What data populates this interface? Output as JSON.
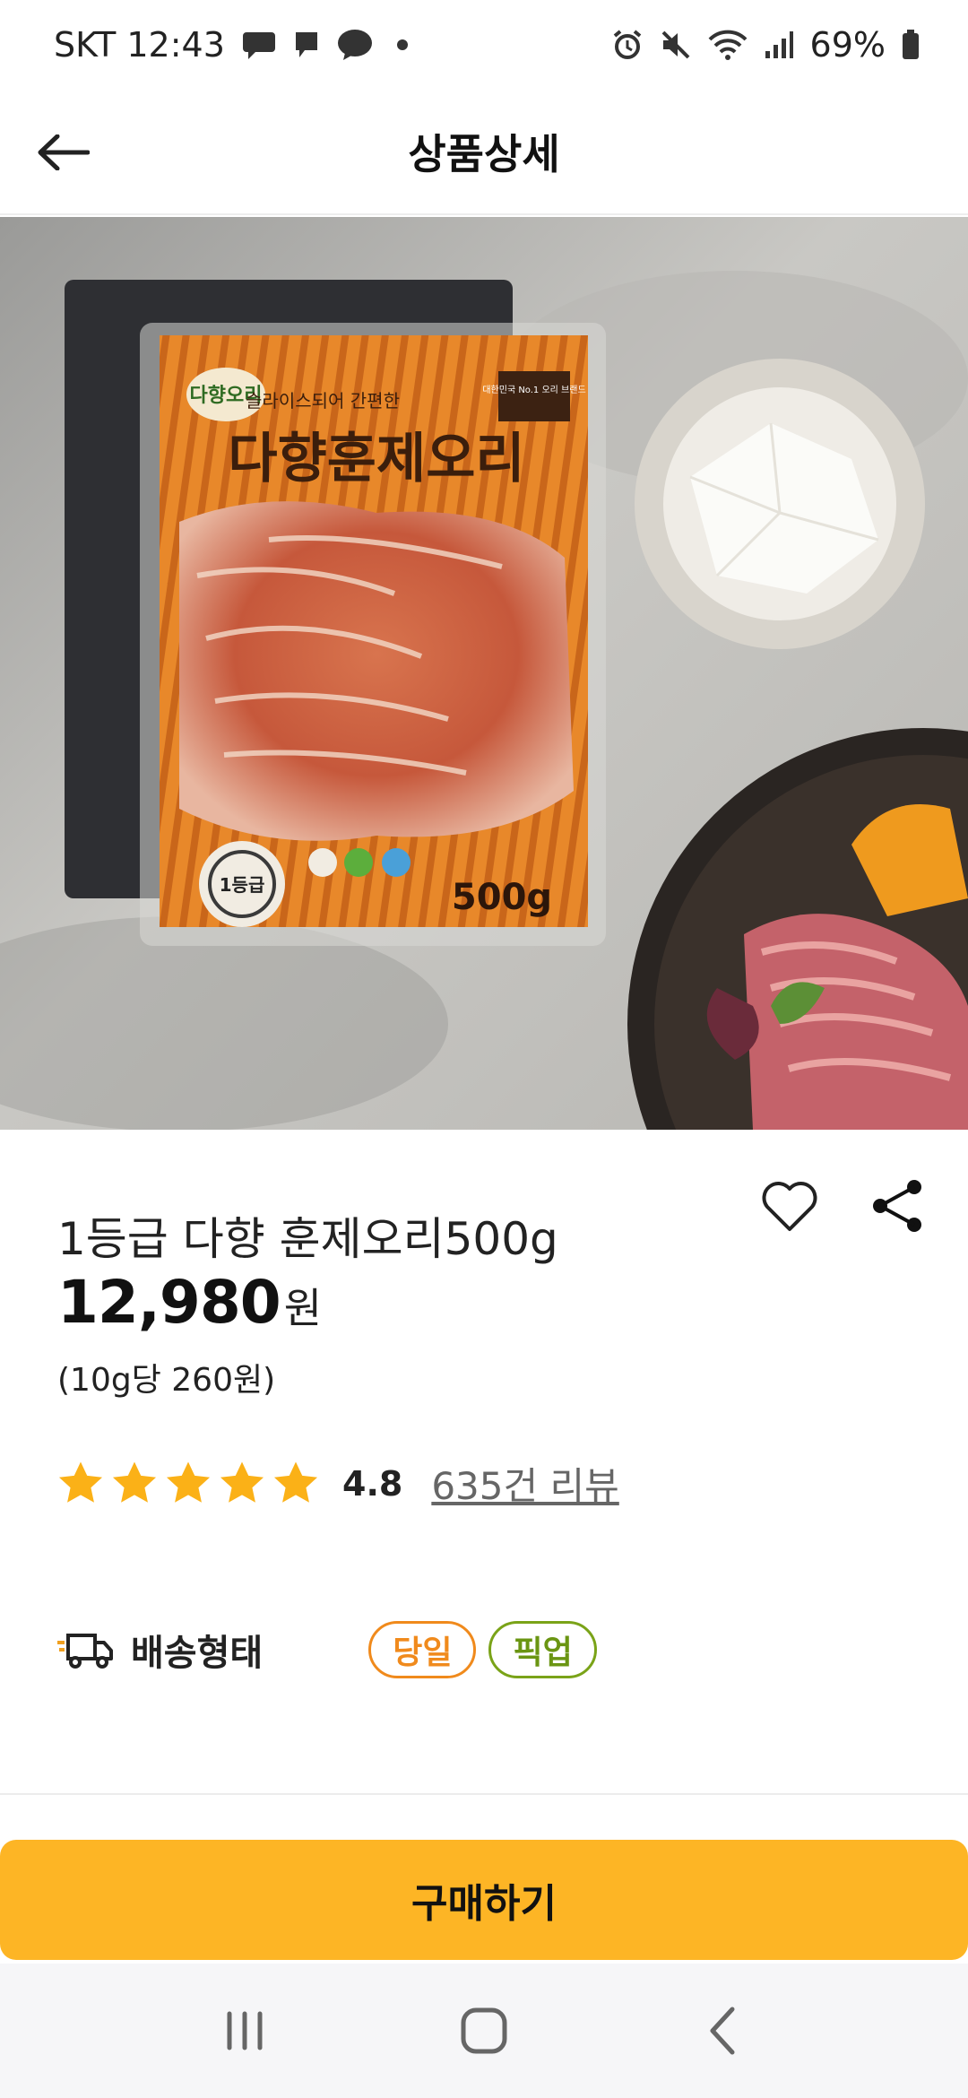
{
  "status_bar": {
    "carrier_time": "SKT 12:43",
    "battery": "69%"
  },
  "header": {
    "title": "상품상세"
  },
  "product_image": {
    "package_brand": "다향오리",
    "package_tagline": "슬라이스되어 간편한",
    "package_title": "다향훈제오리",
    "package_weight": "500g",
    "package_badge": "1등급",
    "package_rank": "대한민국 No.1 오리 브랜드"
  },
  "product": {
    "name": "1등급 다향 훈제오리500g",
    "price": "12,980",
    "currency": "원",
    "unit_price": "(10g당 260원)",
    "rating": 4.8,
    "rating_text": "4.8",
    "review_link": "635건 리뷰"
  },
  "delivery": {
    "label": "배송형태",
    "badges": [
      "당일",
      "픽업"
    ]
  },
  "buy_button": {
    "label": "구매하기"
  },
  "colors": {
    "accent": "#fdb525",
    "star": "#fbb117",
    "same_day": "#f08a1c",
    "pickup": "#7aa318"
  }
}
